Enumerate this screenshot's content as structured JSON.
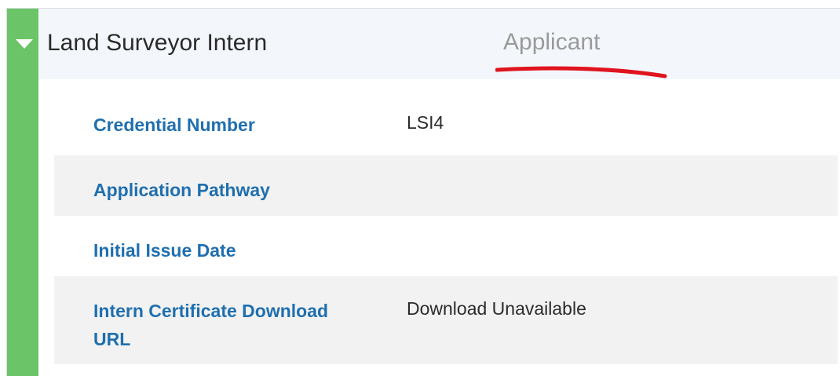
{
  "section": {
    "title": "Land Surveyor Intern",
    "status": "Applicant",
    "accent_color": "#6cc468",
    "annotation_color": "#e0141e",
    "toggle_icon": "caret-down-icon"
  },
  "fields": [
    {
      "label": "Credential Number",
      "value": "LSI4"
    },
    {
      "label": "Application Pathway",
      "value": ""
    },
    {
      "label": "Initial Issue Date",
      "value": ""
    },
    {
      "label": "Intern Certificate Download URL",
      "value": "Download Unavailable"
    }
  ]
}
